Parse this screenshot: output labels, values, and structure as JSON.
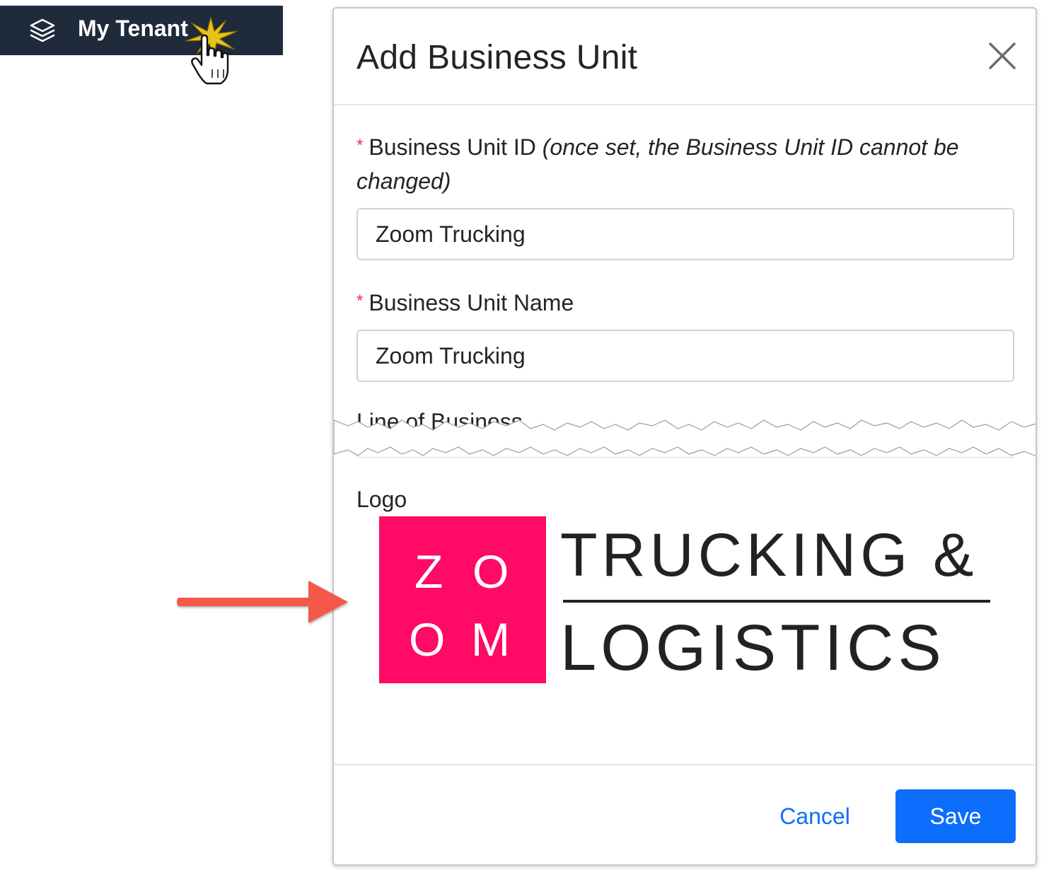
{
  "nav": {
    "tenant_label": "My Tenant",
    "icon": "layers-icon"
  },
  "modal": {
    "title": "Add Business Unit",
    "close_icon": "close-icon",
    "fields": {
      "business_unit_id": {
        "required_mark": "*",
        "label": "Business Unit ID",
        "hint": "(once set, the Business Unit ID cannot be changed)",
        "value": "Zoom Trucking"
      },
      "business_unit_name": {
        "required_mark": "*",
        "label": "Business Unit Name",
        "value": "Zoom Trucking"
      },
      "line_of_business": {
        "label": "Line of Business"
      },
      "logo": {
        "label": "Logo",
        "image": {
          "letters": [
            "Z",
            "O",
            "O",
            "M"
          ],
          "line1": "TRUCKING &",
          "line2": "LOGISTICS"
        }
      }
    },
    "footer": {
      "cancel_label": "Cancel",
      "save_label": "Save"
    }
  },
  "colors": {
    "nav_bg": "#1f2a3a",
    "logo_pink": "#ff0a66",
    "primary": "#0d6efd",
    "required": "#dc3545",
    "annotation_arrow": "#f4584a"
  }
}
